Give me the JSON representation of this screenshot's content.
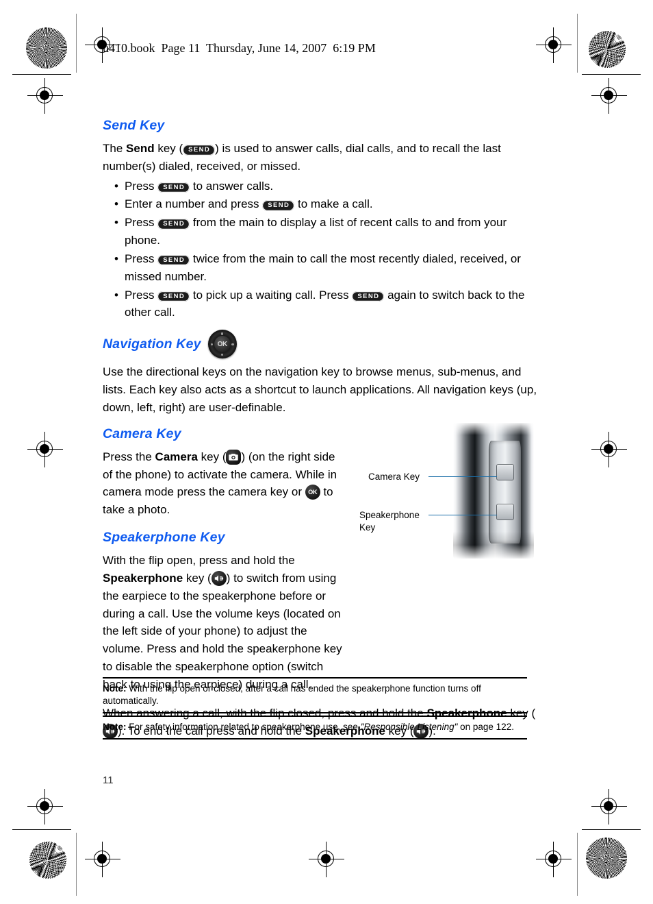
{
  "page": {
    "running_header": "u410.book  Page 11  Thursday, June 14, 2007  6:19 PM",
    "folio": "11",
    "heading_color": "#0f5bf0",
    "callout_line_color": "#1b6ea8"
  },
  "sections": {
    "send_key": {
      "heading": "Send Key",
      "intro_a": "The ",
      "intro_b": "Send",
      "intro_c": " key (",
      "intro_d": ") is used to answer calls, dial calls, and to recall the last number(s) dialed, received, or missed.",
      "bullets": [
        {
          "a": "Press ",
          "b": " to answer calls."
        },
        {
          "a": "Enter a number and press ",
          "b": " to make a call."
        },
        {
          "a": "Press ",
          "b": " from the main to display a list of recent calls to and from your phone."
        },
        {
          "a": "Press ",
          "b": " twice from the main to call the most recently dialed, received, or missed number."
        },
        {
          "a": "Press ",
          "b": " to pick up a waiting call. Press ",
          "c": " again to switch back to the other call."
        }
      ]
    },
    "navigation_key": {
      "heading": "Navigation Key",
      "body": "Use the directional keys on the navigation key to browse menus, sub-menus, and lists. Each key also acts as a shortcut to launch applications. All navigation keys (up, down, left, right) are user-definable."
    },
    "camera_key": {
      "heading": "Camera Key",
      "a": "Press the ",
      "b": "Camera",
      "c": " key (",
      "d": ") (on the right side of the phone) to activate the camera. While in camera mode press the camera key or ",
      "e": " to take a photo."
    },
    "speakerphone_key": {
      "heading": "Speakerphone Key",
      "p1_a": "With the flip open, press and hold the ",
      "p1_b": "Speakerphone",
      "p1_c": " key (",
      "p1_d": ") to switch from using the earpiece to the speakerphone before or during a call. Use the volume keys (located on the left side of your phone) to adjust the volume. Press and hold the speakerphone key to disable the speakerphone option (switch back to using the earpiece) during a call.",
      "p2_a": "When answering a call, with the flip closed, press and hold the ",
      "p2_b": "Speakerphone",
      "p2_c": " key (",
      "p2_d": "). To end the call press and hold the ",
      "p2_e": "Speakerphone",
      "p2_f": " key (",
      "p2_g": ")."
    }
  },
  "photo": {
    "callout_camera": "Camera Key",
    "callout_speakerphone_line1": "Speakerphone",
    "callout_speakerphone_line2": "Key"
  },
  "notes": [
    {
      "label": "Note:",
      "text": " With the flip open or closed, after a call has ended the speakerphone function turns off automatically."
    },
    {
      "label": "Note:",
      "text_a": " For safety information related to speakerphone use, see ",
      "text_b": "\"Responsible Listening\"",
      "text_c": "  on page 122."
    }
  ],
  "icons": {
    "send_label": "SEND",
    "ok_label": "OK",
    "nav_ok_label": "OK"
  }
}
